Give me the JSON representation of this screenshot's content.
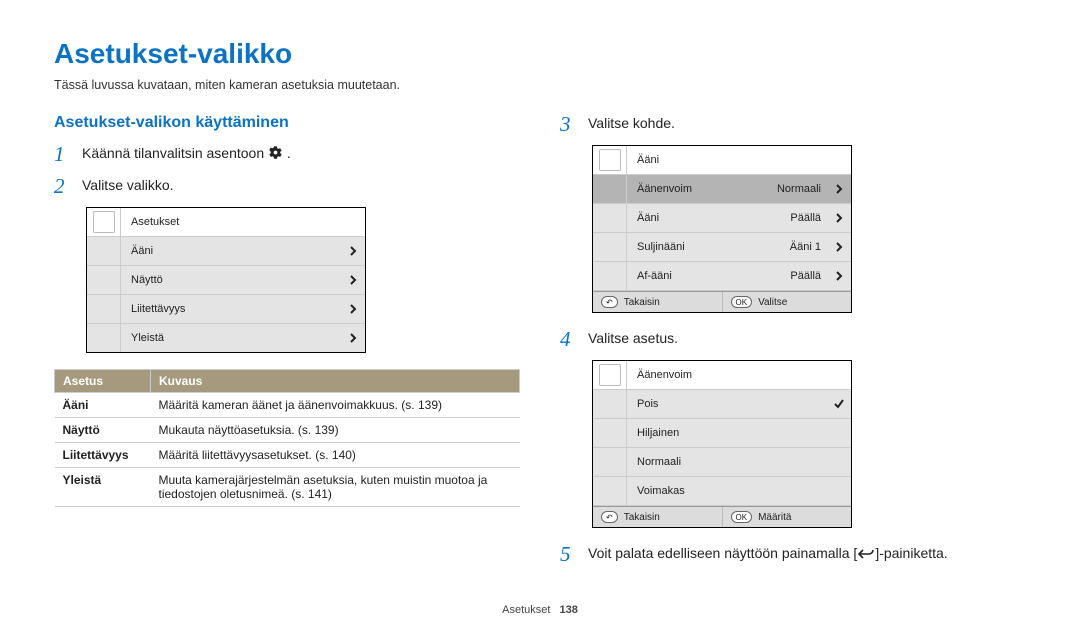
{
  "page": {
    "title": "Asetukset-valikko",
    "intro": "Tässä luvussa kuvataan, miten kameran asetuksia muutetaan."
  },
  "section": {
    "title": "Asetukset-valikon käyttäminen"
  },
  "steps": {
    "s1": {
      "num": "1",
      "before": "Käännä tilanvalitsin asentoon ",
      "after": " ."
    },
    "s2": {
      "num": "2",
      "text": "Valitse valikko."
    },
    "s3": {
      "num": "3",
      "text": "Valitse kohde."
    },
    "s4": {
      "num": "4",
      "text": "Valitse asetus."
    },
    "s5": {
      "num": "5",
      "before": "Voit palata edelliseen näyttöön painamalla [",
      "after": "]-painiketta."
    }
  },
  "panel1": {
    "header": "Asetukset",
    "items": [
      "Ääni",
      "Näyttö",
      "Liitettävyys",
      "Yleistä"
    ]
  },
  "panel2": {
    "header": "Ääni",
    "rows": [
      {
        "label": "Äänenvoim",
        "value": "Normaali",
        "sel": true
      },
      {
        "label": "Ääni",
        "value": "Päällä"
      },
      {
        "label": "Suljinääni",
        "value": "Ääni 1"
      },
      {
        "label": "Af-ääni",
        "value": "Päällä"
      }
    ],
    "footer": {
      "back": "Takaisin",
      "ok": "Valitse"
    }
  },
  "panel3": {
    "header": "Äänenvoim",
    "items": [
      "Pois",
      "Hiljainen",
      "Normaali",
      "Voimakas"
    ],
    "checked_index": 0,
    "footer": {
      "back": "Takaisin",
      "ok": "Määritä"
    }
  },
  "desc_table": {
    "head": {
      "c1": "Asetus",
      "c2": "Kuvaus"
    },
    "rows": [
      {
        "k": "Ääni",
        "v": "Määritä kameran äänet ja äänenvoimakkuus. (s. 139)"
      },
      {
        "k": "Näyttö",
        "v": "Mukauta näyttöasetuksia. (s. 139)"
      },
      {
        "k": "Liitettävyys",
        "v": "Määritä liitettävyysasetukset. (s. 140)"
      },
      {
        "k": "Yleistä",
        "v": "Muuta kamerajärjestelmän asetuksia, kuten muistin muotoa ja tiedostojen oletusnimeä. (s. 141)"
      }
    ]
  },
  "icon_names": {
    "gear": "gear-icon",
    "back": "back-icon",
    "chev": "chevron-right-icon",
    "check": "check-icon",
    "ok_pill": "OK"
  },
  "footer": {
    "category": "Asetukset",
    "page_num": "138"
  }
}
